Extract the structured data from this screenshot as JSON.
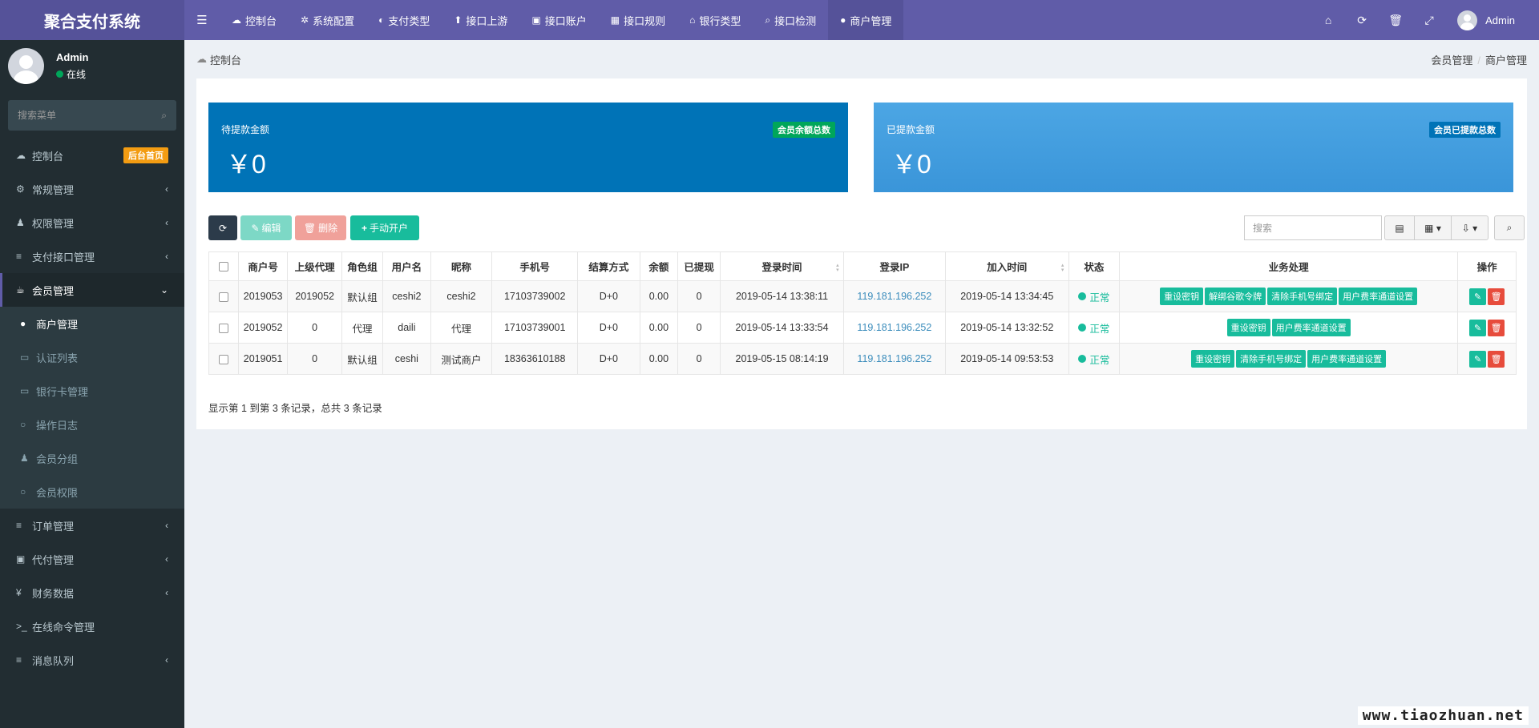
{
  "app": {
    "title": "聚合支付系统"
  },
  "topnav": [
    {
      "icon": "☁",
      "label": "控制台"
    },
    {
      "icon": "✲",
      "label": "系统配置"
    },
    {
      "icon": "◐",
      "label": "支付类型"
    },
    {
      "icon": "⬆",
      "label": "接口上游"
    },
    {
      "icon": "▣",
      "label": "接口账户"
    },
    {
      "icon": "▦",
      "label": "接口规则"
    },
    {
      "icon": "⌂",
      "label": "银行类型"
    },
    {
      "icon": "⌕",
      "label": "接口检测"
    },
    {
      "icon": "●",
      "label": "商户管理"
    }
  ],
  "header_right": {
    "user": "Admin"
  },
  "sidebar": {
    "user": {
      "name": "Admin",
      "status": "在线"
    },
    "search_placeholder": "搜索菜单",
    "items": [
      {
        "icon": "☁",
        "label": "控制台",
        "badge": "后台首页"
      },
      {
        "icon": "⚙",
        "label": "常规管理"
      },
      {
        "icon": "♟",
        "label": "权限管理"
      },
      {
        "icon": "≡",
        "label": "支付接口管理"
      },
      {
        "icon": "☕",
        "label": "会员管理"
      }
    ],
    "subitems": [
      {
        "icon": "●",
        "label": "商户管理"
      },
      {
        "icon": "▭",
        "label": "认证列表"
      },
      {
        "icon": "▭",
        "label": "银行卡管理"
      },
      {
        "icon": "○",
        "label": "操作日志"
      },
      {
        "icon": "♟",
        "label": "会员分组"
      },
      {
        "icon": "○",
        "label": "会员权限"
      }
    ],
    "items_after": [
      {
        "icon": "≡",
        "label": "订单管理"
      },
      {
        "icon": "▣",
        "label": "代付管理"
      },
      {
        "icon": "¥",
        "label": "财务数据"
      },
      {
        "icon": ">_",
        "label": "在线命令管理"
      },
      {
        "icon": "≡",
        "label": "消息队列"
      }
    ]
  },
  "breadcrumb": {
    "left": "控制台",
    "right": [
      "会员管理",
      "商户管理"
    ]
  },
  "stats": [
    {
      "title": "待提款金额",
      "value": "￥0",
      "badge": "会员余额总数"
    },
    {
      "title": "已提款金额",
      "value": "￥0",
      "badge": "会员已提款总数"
    }
  ],
  "toolbar": {
    "edit": "编辑",
    "delete": "删除",
    "add": "手动开户",
    "search_placeholder": "搜索"
  },
  "table": {
    "headers": [
      "商户号",
      "上级代理",
      "角色组",
      "用户名",
      "昵称",
      "手机号",
      "结算方式",
      "余额",
      "已提现",
      "登录时间",
      "登录IP",
      "加入时间",
      "状态",
      "业务处理",
      "操作"
    ],
    "rows": [
      {
        "id": "2019053",
        "parent": "2019052",
        "role": "默认组",
        "username": "ceshi2",
        "nickname": "ceshi2",
        "phone": "17103739002",
        "settle": "D+0",
        "balance": "0.00",
        "withdrawn": "0",
        "login_time": "2019-05-14 13:38:11",
        "ip": "119.181.196.252",
        "join_time": "2019-05-14 13:34:45",
        "status": "正常",
        "actions": [
          "重设密钥",
          "解绑谷歌令牌",
          "清除手机号绑定",
          "用户费率通道设置"
        ]
      },
      {
        "id": "2019052",
        "parent": "0",
        "role": "代理",
        "username": "daili",
        "nickname": "代理",
        "phone": "17103739001",
        "settle": "D+0",
        "balance": "0.00",
        "withdrawn": "0",
        "login_time": "2019-05-14 13:33:54",
        "ip": "119.181.196.252",
        "join_time": "2019-05-14 13:32:52",
        "status": "正常",
        "actions": [
          "重设密钥",
          "用户费率通道设置"
        ]
      },
      {
        "id": "2019051",
        "parent": "0",
        "role": "默认组",
        "username": "ceshi",
        "nickname": "测试商户",
        "phone": "18363610188",
        "settle": "D+0",
        "balance": "0.00",
        "withdrawn": "0",
        "login_time": "2019-05-15 08:14:19",
        "ip": "119.181.196.252",
        "join_time": "2019-05-14 09:53:53",
        "status": "正常",
        "actions": [
          "重设密钥",
          "清除手机号绑定",
          "用户费率通道设置"
        ]
      }
    ],
    "pager": "显示第 1 到第 3 条记录，总共 3 条记录"
  },
  "watermark": "www.tiaozhuan.net",
  "colors": {
    "header": "#605ca8",
    "sidebar": "#222d32",
    "primary": "#0073b7",
    "success": "#18bc9c",
    "danger": "#e74c3c"
  }
}
